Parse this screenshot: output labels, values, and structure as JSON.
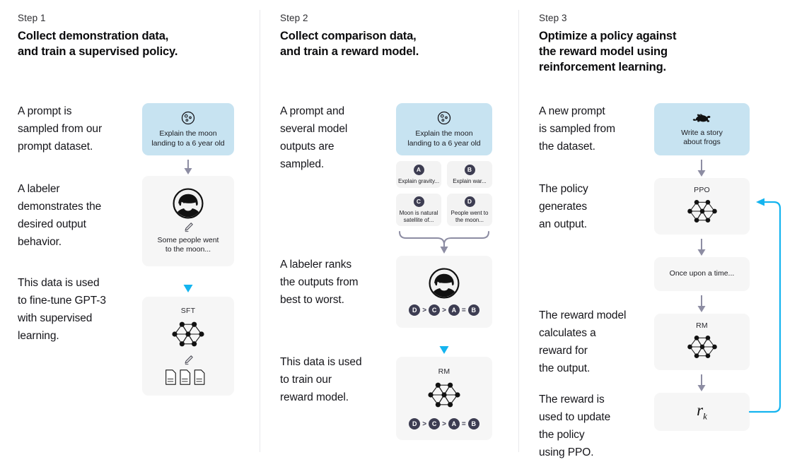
{
  "columns": [
    {
      "step_label": "Step 1",
      "title": "Collect demonstration data,\nand train a supervised policy.",
      "notes": [
        "A prompt is\nsampled from our\nprompt dataset.",
        "A labeler\ndemonstrates the\ndesired output\nbehavior.",
        "This data is used\nto fine-tune GPT-3\nwith supervised\nlearning."
      ],
      "prompt_box": {
        "icon": "moon-icon",
        "text": "Explain the moon\nlanding to a 6 year old"
      },
      "demo_box": {
        "icon": "person-avatar-icon",
        "pencil": "pencil-icon",
        "text": "Some people went\nto the moon..."
      },
      "model_box": {
        "caption": "SFT",
        "network": "neural-network-icon",
        "pencil": "pencil-icon",
        "docs": "documents-icon"
      }
    },
    {
      "step_label": "Step 2",
      "title": "Collect comparison data,\nand train a reward model.",
      "notes": [
        "A prompt and\nseveral model\noutputs are\nsampled.",
        "A labeler ranks\nthe outputs from\nbest to worst.",
        "This data is used\nto train our\nreward model."
      ],
      "prompt_box": {
        "icon": "moon-icon",
        "text": "Explain the moon\nlanding to a 6 year old"
      },
      "options": [
        {
          "badge": "A",
          "text": "Explain gravity..."
        },
        {
          "badge": "B",
          "text": "Explain war..."
        },
        {
          "badge": "C",
          "text": "Moon is natural\nsatellite of..."
        },
        {
          "badge": "D",
          "text": "People went to\nthe moon..."
        }
      ],
      "rank_box": {
        "icon": "person-avatar-icon",
        "ranking": [
          "D",
          ">",
          "C",
          ">",
          "A",
          "=",
          "B"
        ]
      },
      "rm_box": {
        "caption": "RM",
        "network": "neural-network-icon",
        "ranking": [
          "D",
          ">",
          "C",
          ">",
          "A",
          "=",
          "B"
        ]
      }
    },
    {
      "step_label": "Step 3",
      "title": "Optimize a policy against\nthe reward model using\nreinforcement learning.",
      "notes": [
        "A new prompt\nis sampled from\nthe dataset.",
        "The policy\ngenerates\nan output.",
        "The reward model\ncalculates a\nreward for\nthe output.",
        "The reward is\nused to update\nthe policy\nusing PPO."
      ],
      "prompt_box": {
        "icon": "frog-icon",
        "text": "Write a story\nabout frogs"
      },
      "ppo_box": {
        "caption": "PPO",
        "network": "neural-network-icon"
      },
      "output_box": {
        "text": "Once upon a time..."
      },
      "rm_box": {
        "caption": "RM",
        "network": "neural-network-icon"
      },
      "reward_box": {
        "symbol": "r",
        "subscript": "k"
      }
    }
  ],
  "colors": {
    "prompt_blue": "#c7e3f1",
    "box_gray": "#f6f6f6",
    "arrow_gray": "#8d8da3",
    "arrow_blue": "#14b4ef",
    "badge_dark": "#3d3d52",
    "divider": "#e9e9ec"
  }
}
